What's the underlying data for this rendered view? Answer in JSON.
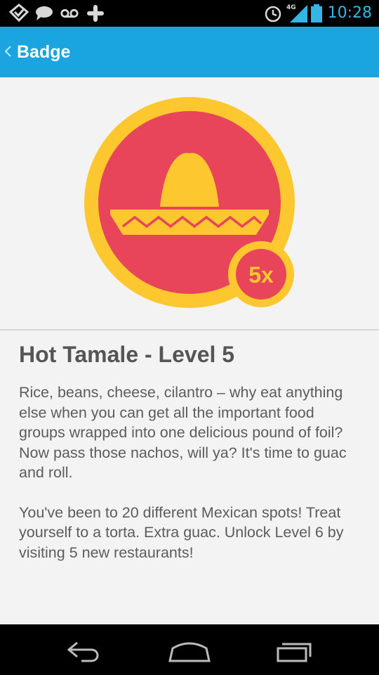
{
  "status_bar": {
    "time": "10:28",
    "network_label": "4G",
    "icons": [
      "foursquare-icon",
      "chat-icon",
      "voicemail-icon",
      "plus-icon",
      "alarm-icon",
      "signal-icon",
      "battery-icon"
    ],
    "color": "#33b5e5"
  },
  "action_bar": {
    "title": "Badge",
    "color": "#1aa5e0"
  },
  "badge": {
    "multiplier": "5x",
    "icon": "sombrero-icon",
    "ring_color": "#fdc82f",
    "fill_color": "#e8445a"
  },
  "content": {
    "title": "Hot Tamale - Level 5",
    "description": "Rice, beans, cheese, cilantro – why eat anything else when you can get all the important food groups wrapped into one delicious pound of foil? Now pass those nachos, will ya? It's time to guac and roll.",
    "progress": "You've been to 20 different Mexican spots! Treat yourself to a torta. Extra guac. Unlock Level 6 by visiting 5 new restaurants!"
  },
  "nav_bar": {
    "icons": [
      "back-icon",
      "home-icon",
      "recent-apps-icon"
    ]
  }
}
